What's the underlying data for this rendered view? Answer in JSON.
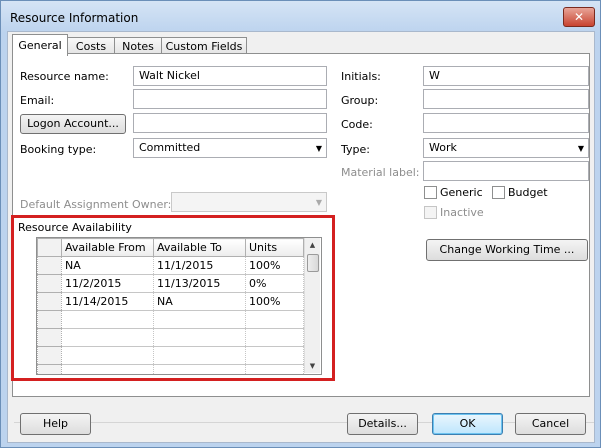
{
  "window": {
    "title": "Resource Information",
    "close_glyph": "✕"
  },
  "tabs": [
    {
      "label": "General",
      "active": true
    },
    {
      "label": "Costs",
      "active": false
    },
    {
      "label": "Notes",
      "active": false
    },
    {
      "label": "Custom Fields",
      "active": false
    }
  ],
  "left": {
    "resource_name_label": "Resource name:",
    "resource_name_value": "Walt Nickel",
    "email_label": "Email:",
    "email_value": "",
    "logon_button": "Logon Account...",
    "logon_value": "",
    "booking_type_label": "Booking type:",
    "booking_type_value": "Committed",
    "default_owner_label": "Default Assignment Owner:",
    "default_owner_value": ""
  },
  "right": {
    "initials_label": "Initials:",
    "initials_value": "W",
    "group_label": "Group:",
    "group_value": "",
    "code_label": "Code:",
    "code_value": "",
    "type_label": "Type:",
    "type_value": "Work",
    "material_label_label": "Material label:",
    "material_label_value": "",
    "generic_label": "Generic",
    "budget_label": "Budget",
    "inactive_label": "Inactive",
    "change_working_time_button": "Change Working Time ..."
  },
  "availability": {
    "title": "Resource Availability",
    "columns": [
      "Available From",
      "Available To",
      "Units"
    ],
    "rows": [
      [
        "NA",
        "11/1/2015",
        "100%"
      ],
      [
        "11/2/2015",
        "11/13/2015",
        "0%"
      ],
      [
        "11/14/2015",
        "NA",
        "100%"
      ],
      [
        "",
        "",
        ""
      ],
      [
        "",
        "",
        ""
      ],
      [
        "",
        "",
        ""
      ],
      [
        "",
        "",
        ""
      ]
    ]
  },
  "footer": {
    "help_button": "Help",
    "details_button": "Details...",
    "ok_button": "OK",
    "cancel_button": "Cancel"
  },
  "colors": {
    "highlight_border": "#d42020",
    "title_bar": "#bcd3ee"
  }
}
